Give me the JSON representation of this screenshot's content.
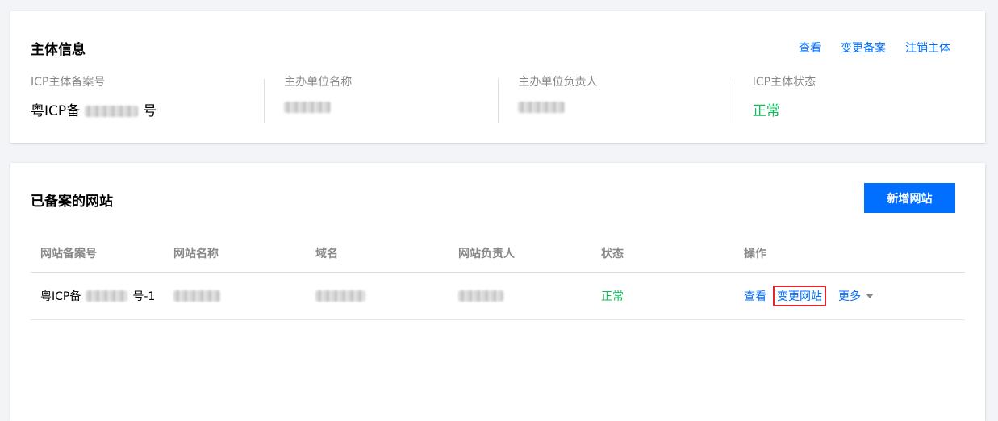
{
  "subject_card": {
    "title": "主体信息",
    "links": [
      "查看",
      "变更备案",
      "注销主体"
    ],
    "fields": [
      {
        "label": "ICP主体备案号",
        "value_prefix": "粤ICP备",
        "value_suffix": "号"
      },
      {
        "label": "主办单位名称"
      },
      {
        "label": "主办单位负责人"
      },
      {
        "label": "ICP主体状态",
        "value": "正常"
      }
    ]
  },
  "websites_card": {
    "title": "已备案的网站",
    "add_button": "新增网站",
    "columns": [
      "网站备案号",
      "网站名称",
      "域名",
      "网站负责人",
      "状态",
      "操作"
    ],
    "rows": [
      {
        "record_prefix": "粤ICP备",
        "record_suffix": "号-1",
        "status": "正常",
        "actions": {
          "view": "查看",
          "change": "变更网站",
          "more": "更多"
        }
      }
    ]
  },
  "colors": {
    "accent": "#006eff",
    "success": "#0abf5b",
    "highlight_border": "#e3262e"
  }
}
